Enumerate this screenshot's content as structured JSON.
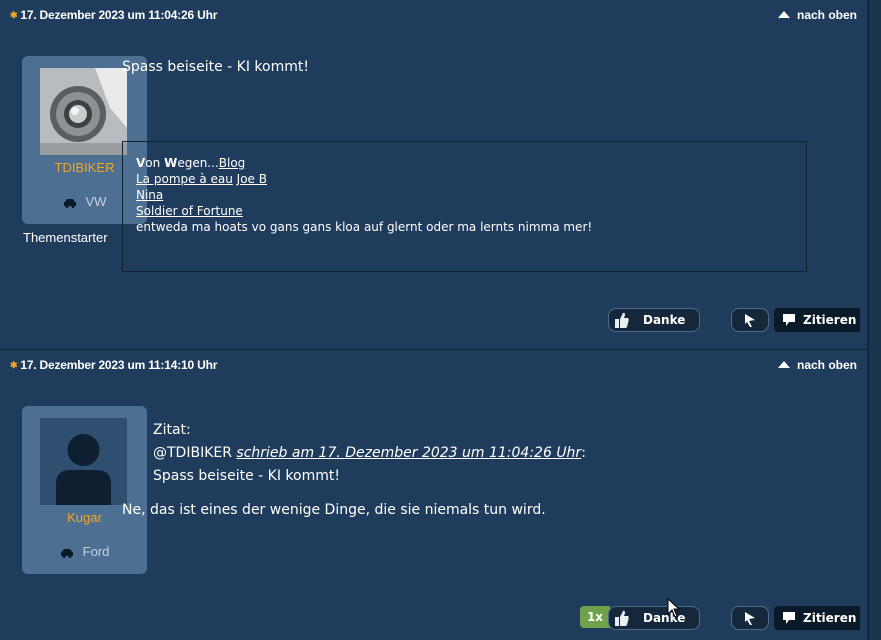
{
  "posts": [
    {
      "date": "17. Dezember 2023 um 11:04:26 Uhr",
      "nach_oben": "nach oben",
      "author": {
        "name": "TDIBIKER",
        "car": "VW",
        "role": "Themenstarter"
      },
      "message": "Spass beiseite - KI kommt!",
      "signature": {
        "line1_bold_v": "V",
        "line1_a": "on ",
        "line1_bold_w": "W",
        "line1_b": "egen...",
        "line1_link": "Blog",
        "line2_link1": "La pompe à eau",
        "line2_link2": "Joe B",
        "line3_link": "Nina",
        "line4_link": "Soldier of Fortune",
        "line5": "entweda ma hoats vo gans gans kloa auf glernt oder ma lernts nimma mer!"
      },
      "actions": {
        "danke": "Danke",
        "zitieren": "Zitieren"
      }
    },
    {
      "date": "17. Dezember 2023 um 11:14:10 Uhr",
      "nach_oben": "nach oben",
      "author": {
        "name": "Kugar",
        "car": "Ford"
      },
      "quote": {
        "label": "Zitat:",
        "mention": "@TDIBIKER",
        "wrote": "schrieb am 17. Dezember 2023 um 11:04:26 Uhr",
        "colon": ":",
        "text": "Spass beiseite - KI kommt!"
      },
      "message": "Ne, das ist eines der wenige Dinge, die sie niemals tun wird.",
      "actions": {
        "count": "1x",
        "danke": "Danke",
        "zitieren": "Zitieren"
      }
    }
  ],
  "colors": {
    "background": "#1f3c5d",
    "card": "#4d6f91",
    "username": "#f5a623",
    "count_badge": "#6fa24a"
  }
}
